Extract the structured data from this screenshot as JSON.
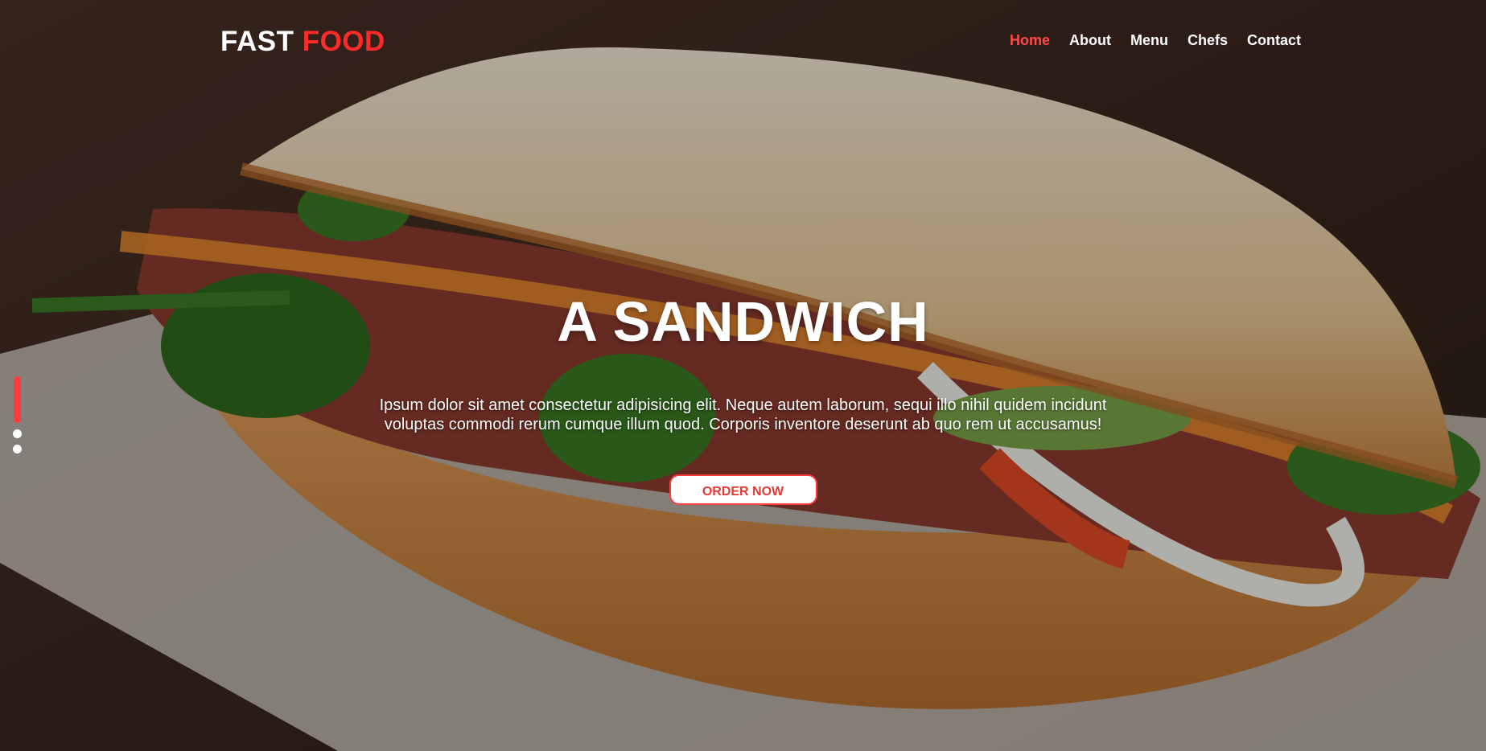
{
  "brand": {
    "name_primary": "FAST",
    "name_accent": "FOOD",
    "accent_color": "#ff2a2a"
  },
  "nav": {
    "items": [
      {
        "label": "Home",
        "active": true
      },
      {
        "label": "About",
        "active": false
      },
      {
        "label": "Menu",
        "active": false
      },
      {
        "label": "Chefs",
        "active": false
      },
      {
        "label": "Contact",
        "active": false
      }
    ],
    "active_color": "#ff4a4a"
  },
  "hero": {
    "title": "A SANDWICH",
    "description": "Ipsum dolor sit amet consectetur adipisicing elit. Neque autem laborum, sequi illo nihil quidem incidunt voluptas commodi rerum cumque illum quod. Corporis inventore deserunt ab quo rem ut accusamus!",
    "cta_label": "ORDER NOW",
    "background_image": "sandwich-photo"
  },
  "slider": {
    "total_slides": 3,
    "active_index": 0,
    "active_color": "#ff3b3b"
  }
}
